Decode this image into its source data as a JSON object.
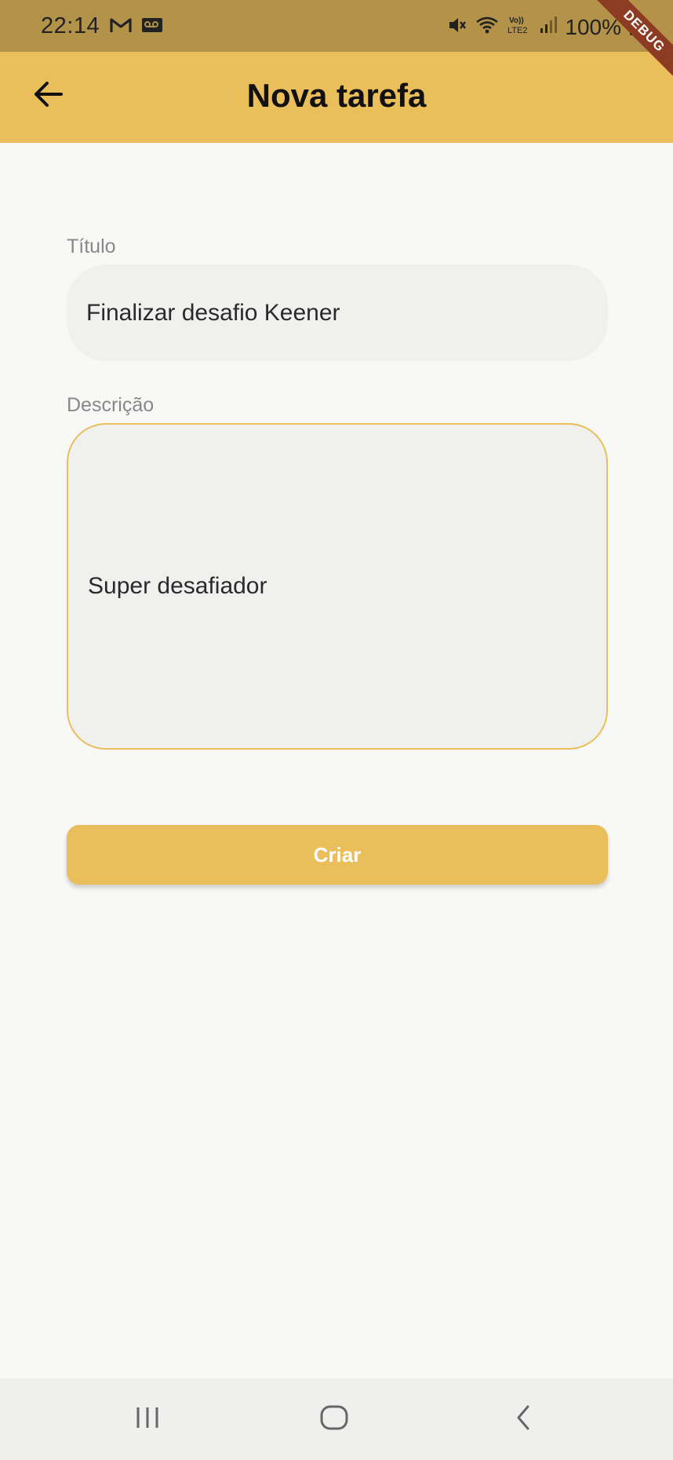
{
  "status_bar": {
    "time": "22:14",
    "battery": "100%",
    "icons": [
      "gmail-icon",
      "voicemail-icon",
      "mute-icon",
      "wifi-icon",
      "volte-lte2-icon",
      "signal-icon",
      "battery-icon"
    ],
    "debug_badge": "DEBUG"
  },
  "app_bar": {
    "title": "Nova tarefa",
    "back_icon": "arrow-back-icon",
    "background": "#eabe5b"
  },
  "form": {
    "title_label": "Título",
    "title_value": "Finalizar desafio Keener",
    "description_label": "Descrição",
    "description_value": "Super desafiador",
    "submit_label": "Criar"
  },
  "nav_bar": {
    "items": [
      "recent-apps-icon",
      "home-icon",
      "back-icon"
    ]
  },
  "colors": {
    "accent": "#eabe5b",
    "status_bar": "#b3924a",
    "field_bg": "#f0f1ef",
    "page_bg": "#f8f9f7"
  }
}
